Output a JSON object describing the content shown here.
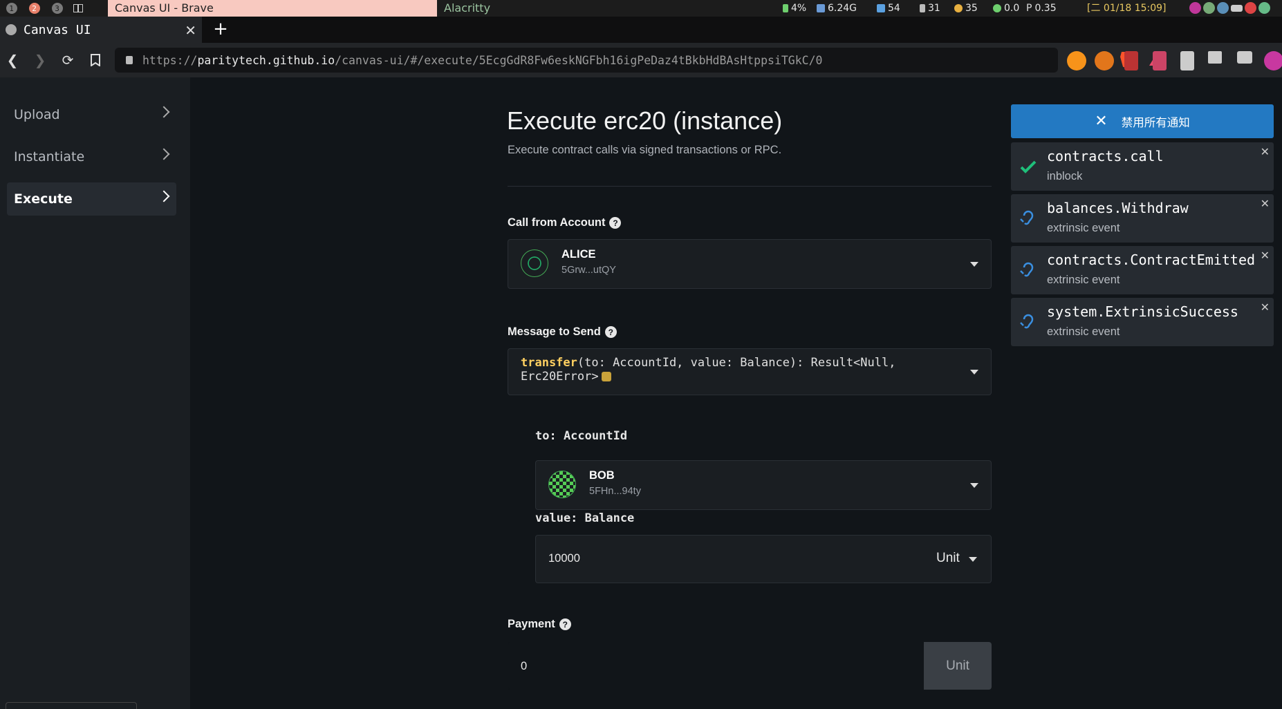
{
  "os_bar": {
    "workspaces": [
      "1",
      "2",
      "3"
    ],
    "active_workspace": "2",
    "active_window_title": "Canvas UI - Brave",
    "other_window_title": "Alacritty",
    "battery": "4%",
    "disk": "6.24G",
    "wifi": "54",
    "volume": "31",
    "brightness": "35",
    "cpu_load": "0.0",
    "proc_load": "0.35",
    "datetime": "[二 01/18 15:09]"
  },
  "browser": {
    "tab_title": "Canvas UI",
    "url_prefix": "https://",
    "url_host": "paritytech.github.io",
    "url_path": "/canvas-ui/#/execute/5EcgGdR8Fw6eskNGFbh16igPeDaz4tBkbHdBAsHtppsiTGkC/0"
  },
  "sidebar": {
    "items": [
      {
        "label": "Upload"
      },
      {
        "label": "Instantiate"
      },
      {
        "label": "Execute"
      }
    ]
  },
  "page": {
    "title": "Execute erc20 (instance)",
    "subtitle": "Execute contract calls via signed transactions or RPC.",
    "call_from_label": "Call from Account",
    "caller": {
      "name": "ALICE",
      "address": "5Grw...utQY"
    },
    "message_label": "Message to Send",
    "message_fn": "transfer",
    "message_sig": "(to: AccountId, value: Balance): Result<Null, Erc20Error>",
    "arg_to_label": "to: AccountId",
    "arg_to_account": {
      "name": "BOB",
      "address": "5FHn...94ty"
    },
    "arg_value_label": "value: Balance",
    "arg_value": "10000",
    "arg_value_unit": "Unit",
    "payment_label": "Payment",
    "payment_value": "0",
    "payment_unit": "Unit"
  },
  "notifications": {
    "dismiss_all_label": "禁用所有通知",
    "items": [
      {
        "title": "contracts.call",
        "subtitle": "inblock",
        "icon": "check-icon"
      },
      {
        "title": "balances.Withdraw",
        "subtitle": "extrinsic event",
        "icon": "ear-icon"
      },
      {
        "title": "contracts.ContractEmitted",
        "subtitle": "extrinsic event",
        "icon": "ear-icon"
      },
      {
        "title": "system.ExtrinsicSuccess",
        "subtitle": "extrinsic event",
        "icon": "ear-icon"
      }
    ]
  },
  "colors": {
    "accent": "#2379c2",
    "highlight_fn": "#ffd061",
    "success": "#1fbf7a",
    "event_icon": "#3a8fe0"
  }
}
